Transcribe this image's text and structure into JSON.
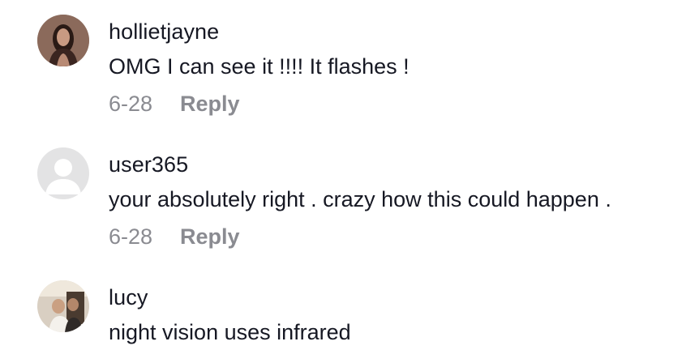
{
  "comments": [
    {
      "username": "hollietjayne",
      "text": "OMG I can see it !!!! It flashes !",
      "date": "6-28",
      "reply_label": "Reply",
      "avatar": "user-photo-avatar"
    },
    {
      "username": "user365",
      "text": "your absolutely right . crazy how this could happen .",
      "date": "6-28",
      "reply_label": "Reply",
      "avatar": "default-user-avatar"
    },
    {
      "username": "lucy",
      "text": "night vision uses infrared",
      "avatar": "user-photo-avatar"
    }
  ],
  "colors": {
    "text_primary": "#161823",
    "text_secondary": "#8a8b91",
    "default_avatar_bg": "#e3e3e4",
    "default_avatar_fg": "#ffffff"
  }
}
